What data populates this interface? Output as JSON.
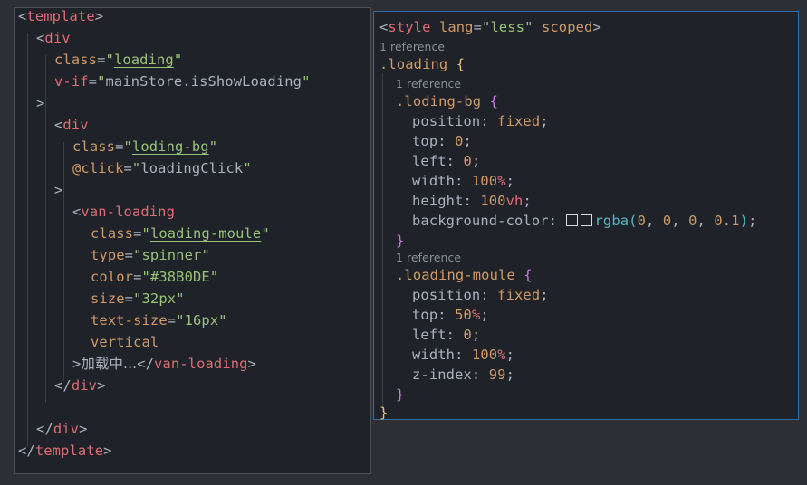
{
  "template_pane": {
    "open_tag": "template",
    "close_tag": "template",
    "outer_div": {
      "tag": "div",
      "class_attr": "class",
      "class_value": "loading",
      "vif_attr": "v-if",
      "vif_value": "mainStore.isShowLoading"
    },
    "inner_div": {
      "tag": "div",
      "class_attr": "class",
      "class_value": "loding-bg",
      "click_attr": "@click",
      "click_value": "loadingClick"
    },
    "van_loading": {
      "tag": "van-loading",
      "attrs": [
        {
          "name": "class",
          "value": "loading-moule"
        },
        {
          "name": "type",
          "value": "spinner"
        },
        {
          "name": "color",
          "value": "#38B0DE"
        },
        {
          "name": "size",
          "value": "32px"
        },
        {
          "name": "text-size",
          "value": "16px"
        }
      ],
      "flag_attr": "vertical",
      "content": "加载中..."
    }
  },
  "style_pane": {
    "open_tag": "style",
    "lang_attr": "lang",
    "lang_value": "less",
    "scoped_attr": "scoped",
    "codelens": "1 reference",
    "root_selector": ".loading",
    "blocks": [
      {
        "selector": ".loding-bg",
        "decls": [
          {
            "prop": "position",
            "value": "fixed"
          },
          {
            "prop": "top",
            "value": "0"
          },
          {
            "prop": "left",
            "value": "0"
          },
          {
            "prop": "width",
            "num": "100",
            "unit": "%"
          },
          {
            "prop": "height",
            "num": "100",
            "unit": "vh"
          },
          {
            "prop": "background-color",
            "func": "rgba",
            "args": [
              "0",
              "0",
              "0",
              "0.1"
            ]
          }
        ]
      },
      {
        "selector": ".loading-moule",
        "decls": [
          {
            "prop": "position",
            "value": "fixed"
          },
          {
            "prop": "top",
            "num": "50",
            "unit": "%"
          },
          {
            "prop": "left",
            "value": "0"
          },
          {
            "prop": "width",
            "num": "100",
            "unit": "%"
          },
          {
            "prop": "z-index",
            "value": "99"
          }
        ]
      }
    ]
  },
  "colors": {
    "background": "#2d2f35",
    "editor": "#1f2329",
    "tag": "#e06c75",
    "attribute": "#d19a66",
    "string": "#98c379",
    "function": "#56b6c2",
    "brace": "#c678dd",
    "right_border": "#2c6faa"
  }
}
